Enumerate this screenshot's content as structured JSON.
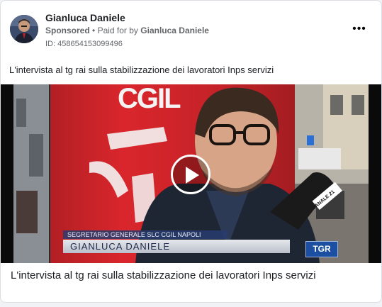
{
  "post": {
    "advertiser_name": "Gianluca Daniele",
    "sponsored_label": "Sponsored",
    "separator": "•",
    "paid_for_prefix": "Paid for by",
    "paid_for_name": "Gianluca Daniele",
    "ad_id": "ID: 458654153099496",
    "more_icon": "more-horizontal-icon",
    "more_glyph": "•••",
    "body_text": "L'intervista al tg rai sulla stabilizzazione dei lavoratori Inps servizi"
  },
  "video": {
    "play_icon": "play-icon",
    "banner_letters": "CGIL",
    "lower_third_role": "SEGRETARIO GENERALE SLC CGIL NAPOLI",
    "lower_third_name": "GIANLUCA DANIELE",
    "channel_logo": "TGR",
    "microphone_brand": "CANALE 21"
  },
  "link_card": {
    "headline": "L'intervista al tg rai sulla stabilizzazione dei lavoratori Inps servizi"
  },
  "colors": {
    "banner_red": "#d9262c",
    "card_border": "#dadde1",
    "meta_gray": "#65676b"
  }
}
